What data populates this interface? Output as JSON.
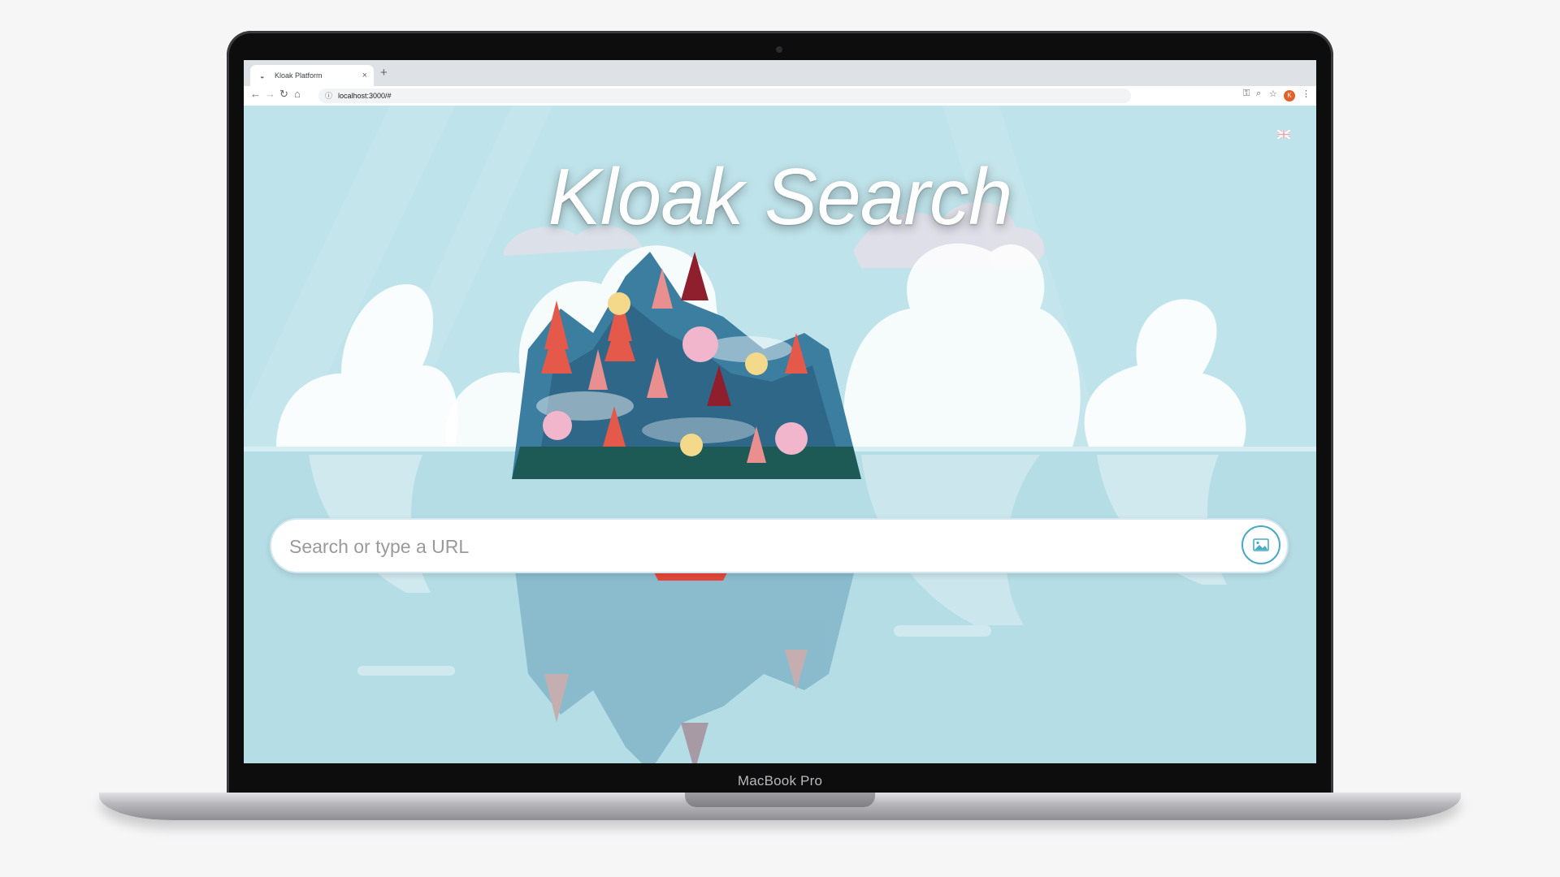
{
  "browser": {
    "tab_title": "Kloak Platform",
    "tab_close": "×",
    "new_tab": "+",
    "url": "localhost:3000/#",
    "profile_initial": "K",
    "nav": {
      "back": "←",
      "forward": "→",
      "reload": "↻",
      "home": "⌂"
    },
    "toolbar_icons": {
      "key": "⚿",
      "zoom": "⌕",
      "bookmark": "☆",
      "menu": "⋮"
    }
  },
  "page": {
    "title": "Kloak Search",
    "search": {
      "placeholder": "Search or type a URL",
      "value": ""
    },
    "language_flag": "UK flag"
  },
  "device": {
    "label": "MacBook Pro"
  },
  "colors": {
    "accent": "#4aa9c3",
    "sky": "#bfe3ea",
    "water": "#b2dce5"
  }
}
